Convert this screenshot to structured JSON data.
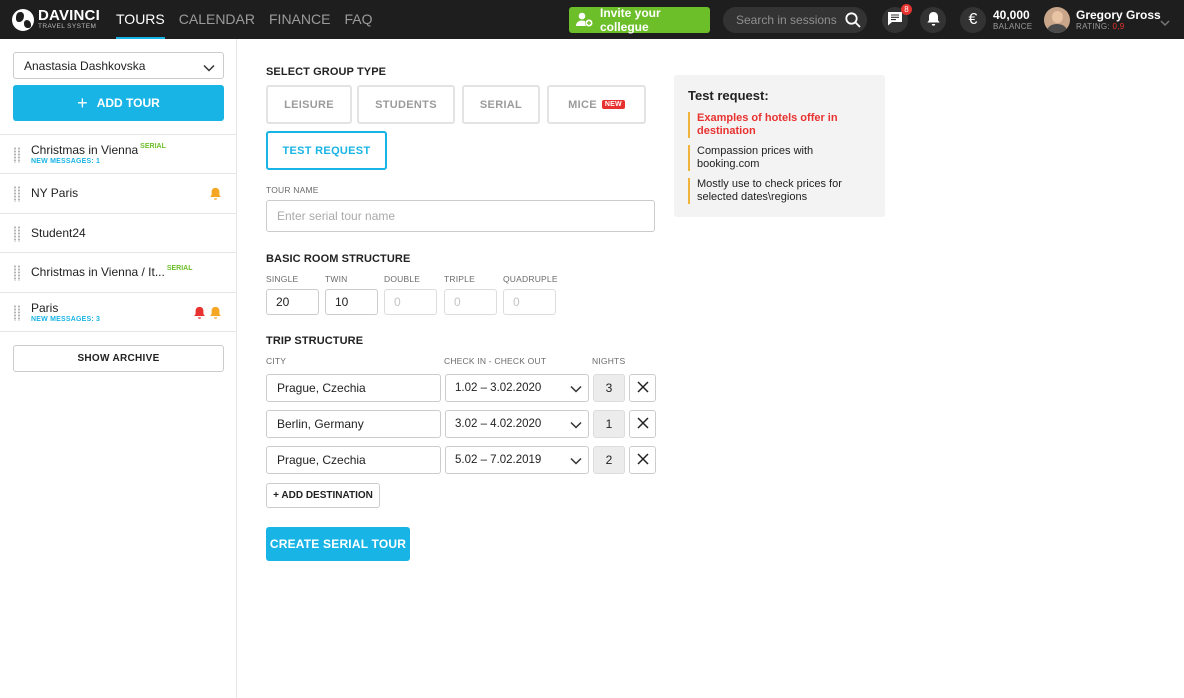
{
  "header": {
    "logo": {
      "name": "DAVINCI",
      "sub": "TRAVEL SYSTEM"
    },
    "nav": [
      {
        "label": "TOURS",
        "active": true
      },
      {
        "label": "CALENDAR",
        "active": false
      },
      {
        "label": "FINANCE",
        "active": false
      },
      {
        "label": "FAQ",
        "active": false
      }
    ],
    "invite_label": "Invite your collegue",
    "search_placeholder": "Search in sessions",
    "messages_badge": "8",
    "balance": {
      "value": "40,000",
      "label": "BALANCE"
    },
    "user": {
      "name": "Gregory Gross",
      "rating_label": "RATING:",
      "rating_value": "0,9"
    }
  },
  "sidebar": {
    "selected_agent": "Anastasia Dashkovska",
    "add_tour_label": "ADD TOUR",
    "tours": [
      {
        "name": "Christmas in Vienna",
        "tag": "SERIAL",
        "sub": "NEW MESSAGES: 1"
      },
      {
        "name": "NY Paris",
        "tag": "",
        "sub": ""
      },
      {
        "name": "Student24",
        "tag": "",
        "sub": ""
      },
      {
        "name": "Christmas in Vienna / It...",
        "tag": "SERIAL",
        "sub": ""
      },
      {
        "name": "Paris",
        "tag": "",
        "sub": "NEW MESSAGES: 3"
      }
    ],
    "show_archive_label": "SHOW ARCHIVE"
  },
  "form": {
    "group_type_title": "SELECT GROUP TYPE",
    "group_types": [
      {
        "label": "LEISURE"
      },
      {
        "label": "STUDENTS"
      },
      {
        "label": "SERIAL"
      },
      {
        "label": "MICE",
        "tag": "NEW"
      },
      {
        "label": "TEST REQUEST",
        "selected": true
      }
    ],
    "tour_name_label": "TOUR NAME",
    "tour_name_placeholder": "Enter serial tour name",
    "room_title": "BASIC ROOM STRUCTURE",
    "rooms": [
      {
        "label": "SINGLE",
        "value": "20",
        "placeholder": "0"
      },
      {
        "label": "TWIN",
        "value": "10",
        "placeholder": "0"
      },
      {
        "label": "DOUBLE",
        "value": "",
        "placeholder": "0"
      },
      {
        "label": "TRIPLE",
        "value": "",
        "placeholder": "0"
      },
      {
        "label": "QUADRUPLE",
        "value": "",
        "placeholder": "0"
      }
    ],
    "trip_title": "TRIP STRUCTURE",
    "trip_columns": {
      "city": "CITY",
      "dates": "CHECK IN - CHECK OUT",
      "nights": "NIGHTS"
    },
    "trip_rows": [
      {
        "city": "Prague, Czechia",
        "dates": "1.02 – 3.02.2020",
        "nights": "3"
      },
      {
        "city": "Berlin, Germany",
        "dates": "3.02 – 4.02.2020",
        "nights": "1"
      },
      {
        "city": "Prague, Czechia",
        "dates": "5.02 – 7.02.2019",
        "nights": "2"
      }
    ],
    "add_destination_label": "+ ADD DESTINATION",
    "create_label": "CREATE SERIAL TOUR"
  },
  "info": {
    "title": "Test request:",
    "items": [
      "Examples of hotels offer in destination",
      "Compassion prices with booking.com",
      "Mostly use to check prices for selected dates\\regions"
    ]
  },
  "colors": {
    "accent": "#18b4e5",
    "invite_green": "#6dbf2a",
    "alert_red": "#e8322f",
    "bell_orange": "#f5a623",
    "topbar": "#1e1e1e"
  }
}
